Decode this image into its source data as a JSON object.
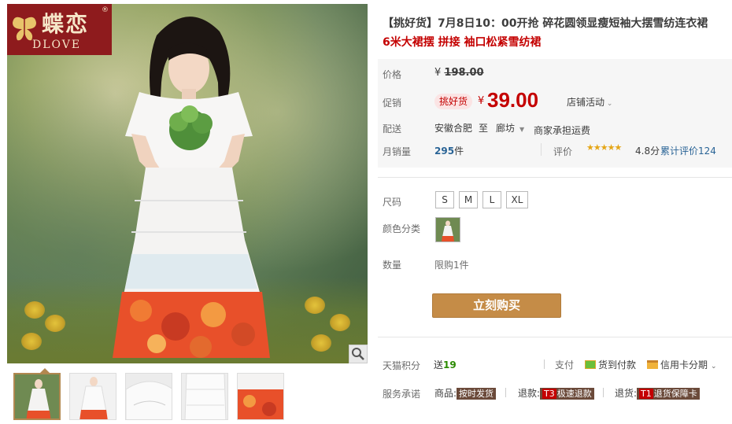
{
  "brand": {
    "name_cn": "蝶恋",
    "name_en": "DLOVE",
    "registered": "®"
  },
  "product": {
    "title_prefix": "【挑好货】",
    "title_main": "7月8日10：00开抢 碎花圆领显瘦短袖大摆雪纺连衣裙",
    "title_sub": "6米大裙摆 拼接 袖口松紧雪纺裙"
  },
  "labels": {
    "price": "价格",
    "promo": "促销",
    "delivery": "配送",
    "monthly_sales": "月销量",
    "size": "尺码",
    "color": "颜色分类",
    "quantity": "数量",
    "points": "天猫积分",
    "service": "服务承诺",
    "review": "评价",
    "pay": "支付"
  },
  "pricing": {
    "original_currency": "¥",
    "original": "198.00",
    "promo_tag": "挑好货",
    "currency": "¥",
    "price": "39.00",
    "store_activity": "店铺活动"
  },
  "delivery": {
    "from": "安徽合肥",
    "to_word": "至",
    "to": "廊坊",
    "shipping": "商家承担运费"
  },
  "sales": {
    "count": "295",
    "unit": "件"
  },
  "rating": {
    "stars": "★★★★★",
    "score": "4.8分",
    "total_label": "累计评价124"
  },
  "sizes": [
    "S",
    "M",
    "L",
    "XL"
  ],
  "quantity": {
    "limit": "限购1件"
  },
  "buy_button": "立刻购买",
  "points": {
    "prefix": "送",
    "value": "19"
  },
  "payment": {
    "cod": "货到付款",
    "credit": "信用卡分期"
  },
  "services": [
    {
      "label": "商品:",
      "badge_tag": "",
      "badge_text": "按时发货"
    },
    {
      "label": "退款:",
      "badge_tag": "T3",
      "badge_text": "极速退款"
    },
    {
      "label": "退货:",
      "badge_tag": "T1",
      "badge_text": "退货保障卡"
    }
  ],
  "colors": {
    "accent_red": "#c40000",
    "buy_button": "#c58c47",
    "brand_bg": "#8e1b1d"
  }
}
